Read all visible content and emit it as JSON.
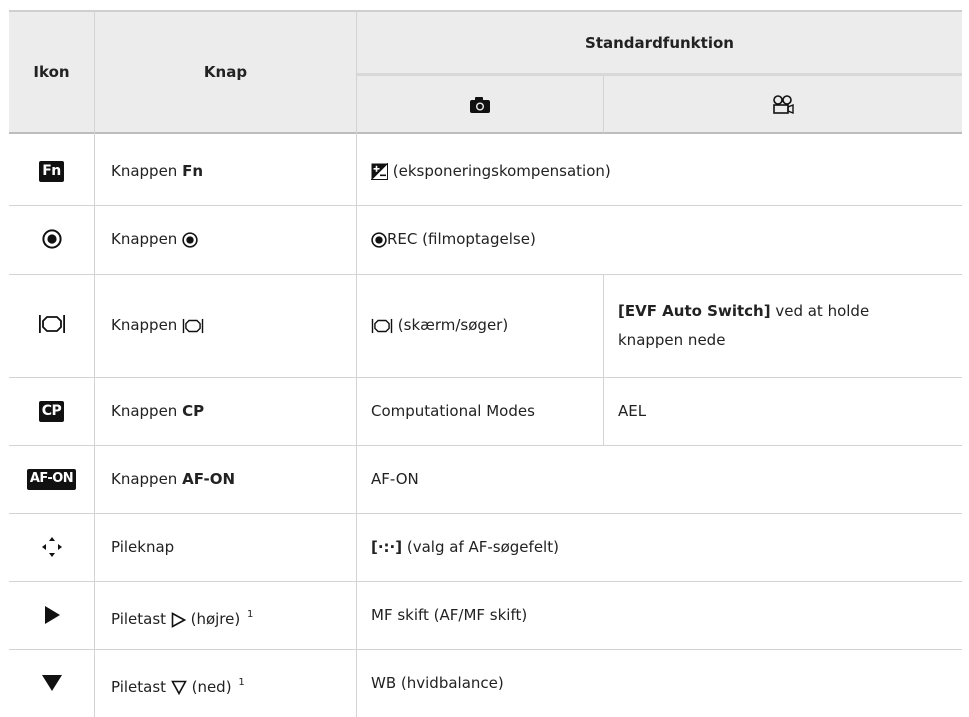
{
  "header": {
    "ikon": "Ikon",
    "knap": "Knap",
    "standard": "Standardfunktion",
    "photo_icon": "camera-icon",
    "movie_icon": "movie-camera-icon"
  },
  "rows": [
    {
      "icon": "Fn",
      "knap_prefix": "Knappen ",
      "knap_bold": "Fn",
      "func": "(eksponeringskompensation)"
    },
    {
      "icon": "record-icon",
      "knap_prefix": "Knappen ",
      "func": "REC (filmoptagelse)"
    },
    {
      "icon": "lv-icon",
      "knap_prefix": "Knappen ",
      "func_photo": "(skærm/søger)",
      "func_movie_bold": "[EVF Auto Switch]",
      "func_movie_line1": " ved at holde",
      "func_movie_line2": "knappen nede"
    },
    {
      "icon": "CP",
      "knap_prefix": "Knappen ",
      "knap_bold": "CP",
      "func_photo": "Computational Modes",
      "func_movie": "AEL"
    },
    {
      "icon": "AF-ON",
      "knap_prefix": "Knappen ",
      "knap_bold": "AF-ON",
      "func": "AF-ON"
    },
    {
      "icon": "arrow-pad-icon",
      "knap": "Pileknap",
      "func_bold": "[·:·]",
      "func": " (valg af AF-søgefelt)"
    },
    {
      "icon": "play-right-icon",
      "knap_prefix": "Piletast ",
      "knap_suffix": " (højre) ",
      "sup": "1",
      "func": "MF skift (AF/MF skift)"
    },
    {
      "icon": "triangle-down-icon",
      "knap_prefix": "Piletast ",
      "knap_suffix": " (ned) ",
      "sup": "1",
      "func": "WB (hvidbalance)"
    }
  ]
}
